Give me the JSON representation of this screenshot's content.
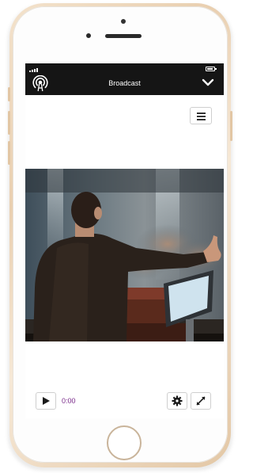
{
  "header": {
    "title": "Broadcast",
    "left_icon": "broadcast-icon",
    "right_icon": "chevron-down-icon"
  },
  "status_bar": {
    "signal_icon": "signal-icon",
    "battery_icon": "battery-icon"
  },
  "menu": {
    "icon": "hamburger-menu-icon"
  },
  "player": {
    "time": "0:00",
    "play_icon": "play-icon",
    "settings_icon": "gear-icon",
    "fullscreen_icon": "expand-icon"
  },
  "colors": {
    "topbar": "#151515",
    "time_text": "#7a2a8a",
    "phone_frame": "#e9cfb0"
  }
}
